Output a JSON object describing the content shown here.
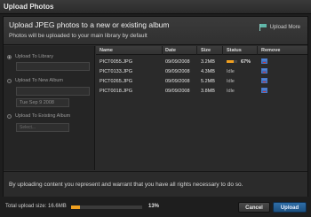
{
  "window": {
    "title": "Upload Photos"
  },
  "header": {
    "heading": "Upload JPEG photos to a new or existing album",
    "subheading": "Photos will be uploaded to your main library by default",
    "upload_more": "Upload More",
    "upload_more_icon": "flag-icon"
  },
  "options": {
    "upload_to_library": "Upload To Library",
    "upload_to_new_album": "Upload To New Album",
    "date_value": "Tue Sep 9 2008",
    "upload_to_existing_album": "Upload To Existing Album",
    "select_placeholder": "Select..."
  },
  "table": {
    "columns": [
      "Name",
      "Date",
      "Size",
      "Status",
      "Remove"
    ],
    "rows": [
      {
        "name": "PICT0055.JPG",
        "date": "09/09/2008",
        "size": "3.2MB",
        "status": "67%",
        "progress": 0.67
      },
      {
        "name": "PICT0133.JPG",
        "date": "09/09/2008",
        "size": "4.3MB",
        "status": "Idle"
      },
      {
        "name": "PICT0265.JPG",
        "date": "09/09/2008",
        "size": "5.2MB",
        "status": "Idle"
      },
      {
        "name": "PICT0018.JPG",
        "date": "09/09/2008",
        "size": "3.8MB",
        "status": "Idle"
      }
    ]
  },
  "terms": "By uploading content you represent and warrant that you have all rights necessary to do so.",
  "footer": {
    "total_label": "Total upload size: 16.6MB",
    "total_progress": 0.13,
    "percent": "13%",
    "cancel": "Cancel",
    "upload": "Upload"
  },
  "colors": {
    "accent": "#f0a020",
    "primary_button": "#2f6ea8"
  }
}
